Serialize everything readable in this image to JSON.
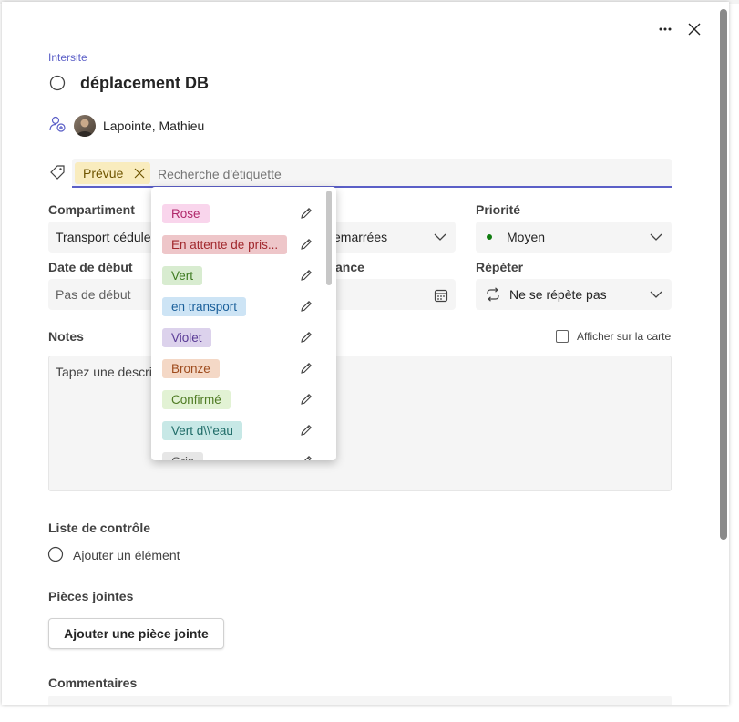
{
  "header": {
    "more_label": "···",
    "close_label": "×"
  },
  "plan_name": "Intersite",
  "task_title": "déplacement DB",
  "assignee": {
    "name": "Lapointe, Mathieu"
  },
  "labels": {
    "applied": "Prévue",
    "search_placeholder": "Recherche d'étiquette"
  },
  "dropdown": {
    "items": [
      {
        "label": "Rose",
        "bg": "#f9d5ec",
        "fg": "#b0286a"
      },
      {
        "label": "En attente de pris...",
        "bg": "#eec6c9",
        "fg": "#a1282d"
      },
      {
        "label": "Vert",
        "bg": "#d8ecd0",
        "fg": "#3c7a1f"
      },
      {
        "label": "en transport",
        "bg": "#cde4f5",
        "fg": "#1a5f9a"
      },
      {
        "label": "Violet",
        "bg": "#dcd2ec",
        "fg": "#5a3b96"
      },
      {
        "label": "Bronze",
        "bg": "#f4d8c6",
        "fg": "#9e4b1d"
      },
      {
        "label": "Confirmé",
        "bg": "#e2f2d4",
        "fg": "#4e7a22"
      },
      {
        "label": "Vert d\\\\'eau",
        "bg": "#c7e8e6",
        "fg": "#1e6b67"
      },
      {
        "label": "Gris",
        "bg": "#e6e6e6",
        "fg": "#555555"
      }
    ]
  },
  "bucket": {
    "label": "Compartiment",
    "value": "Transport cédulez"
  },
  "progress": {
    "value": "emarrées"
  },
  "priority": {
    "label": "Priorité",
    "value": "Moyen",
    "dot_color": "#107c10"
  },
  "start_date": {
    "label": "Date de début",
    "placeholder": "Pas de début"
  },
  "due_date": {
    "label_fragment": "ance"
  },
  "repeat": {
    "label": "Répéter",
    "value": "Ne se répète pas"
  },
  "notes": {
    "label": "Notes",
    "placeholder": "Tapez une descrip"
  },
  "show_on_card": "Afficher sur la carte",
  "checklist": {
    "label": "Liste de contrôle",
    "add_item": "Ajouter un élément"
  },
  "attachments": {
    "label": "Pièces jointes",
    "button": "Ajouter une pièce jointe"
  },
  "comments": {
    "label": "Commentaires"
  },
  "colors": {
    "accent": "#5b5fc7"
  }
}
